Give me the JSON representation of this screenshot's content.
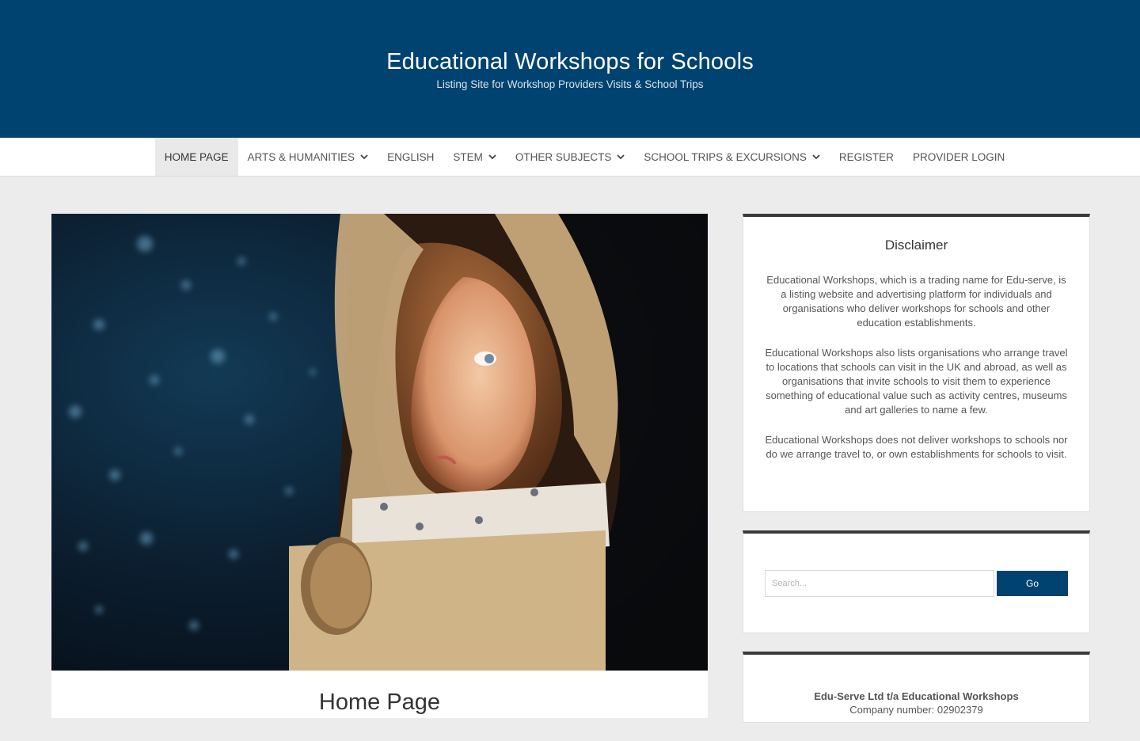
{
  "header": {
    "title": "Educational Workshops for Schools",
    "tagline": "Listing Site for Workshop Providers Visits & School Trips"
  },
  "nav": {
    "items": [
      {
        "label": "HOME PAGE",
        "dropdown": false,
        "active": true
      },
      {
        "label": "ARTS & HUMANITIES",
        "dropdown": true
      },
      {
        "label": "ENGLISH",
        "dropdown": false
      },
      {
        "label": "STEM",
        "dropdown": true
      },
      {
        "label": "OTHER SUBJECTS",
        "dropdown": true
      },
      {
        "label": "SCHOOL TRIPS & EXCURSIONS",
        "dropdown": true
      },
      {
        "label": "REGISTER",
        "dropdown": false
      },
      {
        "label": "PROVIDER LOGIN",
        "dropdown": false
      }
    ]
  },
  "main": {
    "hero_image": "child-in-cardboard-astronaut-helmet",
    "post_title": "Home Page"
  },
  "sidebar": {
    "disclaimer": {
      "title": "Disclaimer",
      "paragraphs": [
        "Educational Workshops, which is a trading name for Edu-serve, is a listing website and advertising platform for individuals and organisations who deliver workshops for schools and other education establishments.",
        "Educational Workshops also lists organisations  who arrange travel to locations that schools can visit in the UK and abroad, as well as organisations that invite schools to visit them to experience something of educational value such as activity centres, museums and art galleries to name a few.",
        "Educational Workshops does not deliver workshops to schools nor do we arrange travel to, or own establishments for schools to visit."
      ]
    },
    "search": {
      "placeholder": "Search...",
      "button_label": "Go"
    },
    "company": {
      "name": "Edu-Serve Ltd t/a Educational Workshops",
      "number": "Company number: 02902379"
    }
  },
  "colors": {
    "brand": "#004370",
    "widget_top_border": "#3a3a3a",
    "page_background": "#ececec"
  }
}
